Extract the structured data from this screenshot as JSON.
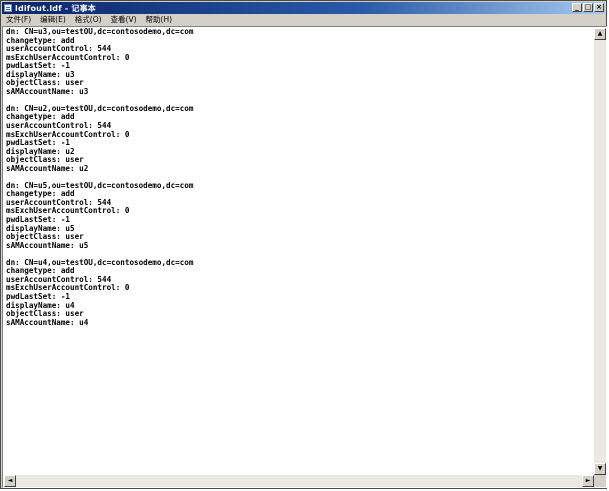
{
  "window": {
    "title": "ldifout.ldf - 记事本",
    "controls": {
      "minimize": "_",
      "maximize": "□",
      "close": "×"
    }
  },
  "menu": [
    {
      "label": "文件(F)"
    },
    {
      "label": "编辑(E)"
    },
    {
      "label": "格式(O)"
    },
    {
      "label": "查看(V)"
    },
    {
      "label": "帮助(H)"
    }
  ],
  "editor": {
    "lines": [
      "dn: CN=u3,ou=testOU,dc=contosodemo,dc=com",
      "changetype: add",
      "userAccountControl: 544",
      "msExchUserAccountControl: 0",
      "pwdLastSet: -1",
      "displayName: u3",
      "objectClass: user",
      "sAMAccountName: u3",
      "",
      "dn: CN=u2,ou=testOU,dc=contosodemo,dc=com",
      "changetype: add",
      "userAccountControl: 544",
      "msExchUserAccountControl: 0",
      "pwdLastSet: -1",
      "displayName: u2",
      "objectClass: user",
      "sAMAccountName: u2",
      "",
      "dn: CN=u5,ou=testOU,dc=contosodemo,dc=com",
      "changetype: add",
      "userAccountControl: 544",
      "msExchUserAccountControl: 0",
      "pwdLastSet: -1",
      "displayName: u5",
      "objectClass: user",
      "sAMAccountName: u5",
      "",
      "dn: CN=u4,ou=testOU,dc=contosodemo,dc=com",
      "changetype: add",
      "userAccountControl: 544",
      "msExchUserAccountControl: 0",
      "pwdLastSet: -1",
      "displayName: u4",
      "objectClass: user",
      "sAMAccountName: u4"
    ]
  },
  "scrollbars": {
    "up": "▲",
    "down": "▼",
    "left": "◄",
    "right": "►"
  }
}
